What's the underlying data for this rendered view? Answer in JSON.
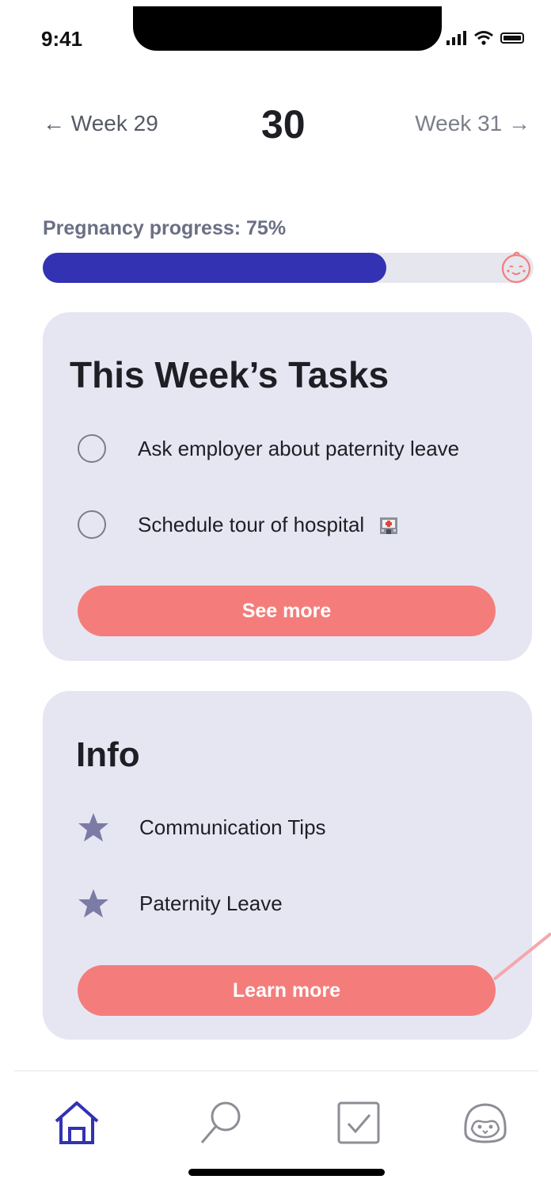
{
  "status": {
    "time": "9:41"
  },
  "week_nav": {
    "prev_label": "← Week 29",
    "current": "30",
    "next_label": "Week 31 →"
  },
  "progress": {
    "label": "Pregnancy progress: 75%",
    "percent": 70,
    "fill_color": "#3232b2"
  },
  "tasks_card": {
    "title": "This Week’s Tasks",
    "items": [
      {
        "label": "Ask employer about paternity leave"
      },
      {
        "label": "Schedule tour of hospital",
        "icon": "hospital-icon"
      }
    ],
    "button_label": "See more"
  },
  "info_card": {
    "title": "Info",
    "items": [
      {
        "label": "Communication Tips",
        "icon": "star-icon"
      },
      {
        "label": "Paternity Leave",
        "icon": "star-icon"
      }
    ],
    "button_label": "Learn more"
  },
  "tab_bar": {
    "tabs": [
      {
        "name": "home",
        "icon": "home-icon",
        "active": true
      },
      {
        "name": "search",
        "icon": "search-icon",
        "active": false
      },
      {
        "name": "tasks",
        "icon": "checkbox-icon",
        "active": false
      },
      {
        "name": "profile",
        "icon": "penguin-icon",
        "active": false
      }
    ]
  },
  "colors": {
    "accent": "#3232b2",
    "button": "#f47d7b",
    "card": "#e6e6f3"
  }
}
